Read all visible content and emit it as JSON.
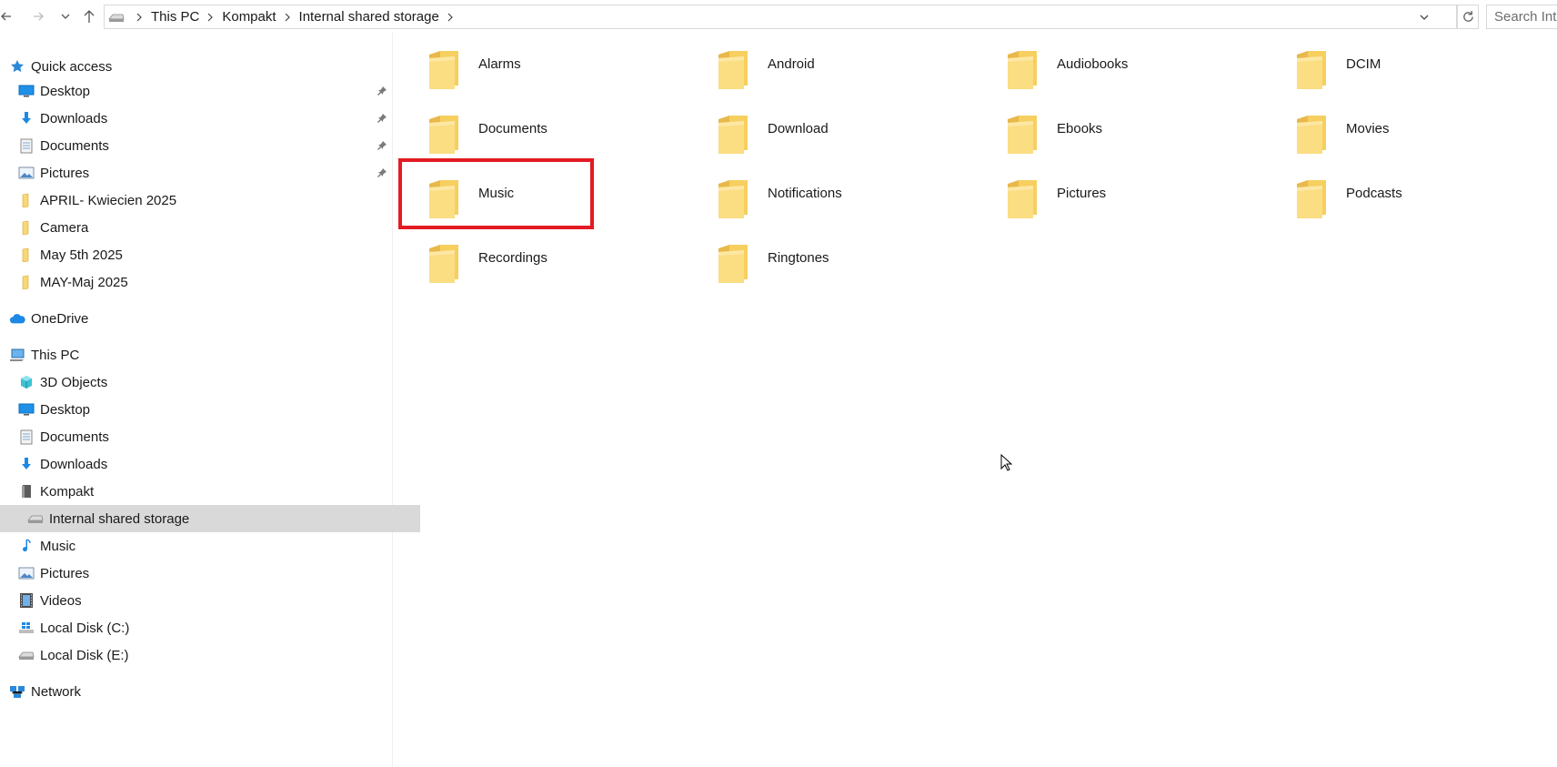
{
  "address_bar": {
    "crumbs": [
      "This PC",
      "Kompakt",
      "Internal shared storage"
    ],
    "search_placeholder": "Search Int"
  },
  "nav": {
    "quick_access": {
      "label": "Quick access",
      "items": [
        {
          "label": "Desktop",
          "icon": "desktop-icon",
          "pinned": true
        },
        {
          "label": "Downloads",
          "icon": "download-arrow-icon",
          "pinned": true
        },
        {
          "label": "Documents",
          "icon": "document-icon",
          "pinned": true
        },
        {
          "label": "Pictures",
          "icon": "pictures-icon",
          "pinned": true
        },
        {
          "label": "APRIL- Kwiecien 2025",
          "icon": "folder-icon",
          "pinned": false
        },
        {
          "label": "Camera",
          "icon": "folder-icon",
          "pinned": false
        },
        {
          "label": "May 5th 2025",
          "icon": "folder-icon",
          "pinned": false
        },
        {
          "label": "MAY-Maj 2025",
          "icon": "folder-icon",
          "pinned": false
        }
      ]
    },
    "onedrive": {
      "label": "OneDrive"
    },
    "this_pc": {
      "label": "This PC",
      "items": [
        {
          "label": "3D Objects",
          "icon": "3d-objects-icon"
        },
        {
          "label": "Desktop",
          "icon": "desktop-icon"
        },
        {
          "label": "Documents",
          "icon": "document-icon"
        },
        {
          "label": "Downloads",
          "icon": "download-arrow-icon"
        },
        {
          "label": "Kompakt",
          "icon": "phone-device-icon"
        },
        {
          "label": "Internal shared storage",
          "icon": "drive-icon",
          "selected": true
        },
        {
          "label": "Music",
          "icon": "music-note-icon"
        },
        {
          "label": "Pictures",
          "icon": "pictures-icon"
        },
        {
          "label": "Videos",
          "icon": "film-icon"
        },
        {
          "label": "Local Disk (C:)",
          "icon": "windows-drive-icon"
        },
        {
          "label": "Local Disk (E:)",
          "icon": "drive-icon"
        }
      ]
    },
    "network": {
      "label": "Network"
    }
  },
  "folders": [
    "Alarms",
    "Android",
    "Audiobooks",
    "DCIM",
    "Documents",
    "Download",
    "Ebooks",
    "Movies",
    "Music",
    "Notifications",
    "Pictures",
    "Podcasts",
    "Recordings",
    "Ringtones"
  ],
  "highlighted_folder": "Music",
  "colors": {
    "highlight": "#e31b23",
    "folder": "#f8d775",
    "selection": "#d9d9d9"
  }
}
